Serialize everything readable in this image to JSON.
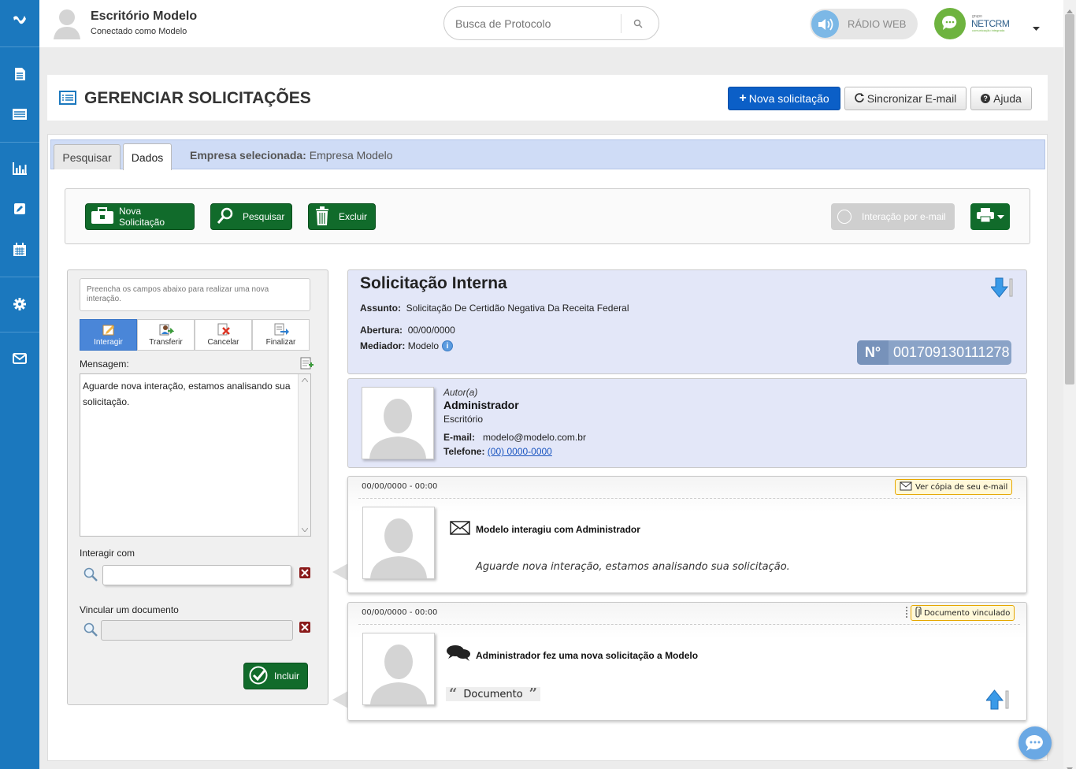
{
  "header": {
    "office_name": "Escritório Modelo",
    "connected_as": "Conectado como Modelo",
    "search_placeholder": "Busca de Protocolo",
    "radio_label": "RÁDIO WEB",
    "brand_name": "NETCRM",
    "brand_top": "grupo",
    "brand_sub": "comunicação integrada"
  },
  "page": {
    "title": "GERENCIAR SOLICITAÇÕES",
    "new_request": "Nova solicitação",
    "sync_email": "Sincronizar E-mail",
    "help": "Ajuda"
  },
  "tabs": [
    {
      "label": "Pesquisar",
      "active": false
    },
    {
      "label": "Dados",
      "active": true
    }
  ],
  "company_bar": {
    "label": "Empresa selecionada:",
    "value": "Empresa Modelo"
  },
  "toolbar": {
    "new": "Nova Solicitação",
    "search": "Pesquisar",
    "delete": "Excluir",
    "email_interaction": "Interação por e-mail"
  },
  "form": {
    "hint": "Preencha os campos abaixo para realizar uma nova interação.",
    "actions": [
      "Interagir",
      "Transferir",
      "Cancelar",
      "Finalizar"
    ],
    "message_label": "Mensagem:",
    "message_value": "Aguarde nova interação, estamos analisando sua solicitação.",
    "interact_with_label": "Interagir com",
    "link_document_label": "Vincular um documento",
    "include_button": "Incluir"
  },
  "request": {
    "title": "Solicitação Interna",
    "subject_label": "Assunto:",
    "subject": "Solicitação De Certidão Negativa Da Receita Federal",
    "opening_label": "Abertura:",
    "opening": "00/00/0000",
    "mediator_label": "Mediador:",
    "mediator": "Modelo",
    "number_label": "N°",
    "number": "001709130111278"
  },
  "author": {
    "role": "Autor(a)",
    "name": "Administrador",
    "org": "Escritório",
    "email_label": "E-mail:",
    "email": "modelo@modelo.com.br",
    "phone_label": "Telefone:",
    "phone": "(00) 0000-0000"
  },
  "interactions": [
    {
      "datetime": "00/00/0000 - 00:00",
      "badge": "Ver cópia de seu e-mail",
      "title": "Modelo interagiu com Administrador",
      "message": "Aguarde nova interação, estamos analisando sua solicitação."
    },
    {
      "datetime": "00/00/0000 - 00:00",
      "badge": "Documento vinculado",
      "title": "Administrador fez uma nova solicitação a Modelo",
      "document": "Documento"
    }
  ],
  "colors": {
    "sidebar": "#1b78be",
    "primary_button": "#0b5fc7",
    "green_button": "#116b2b",
    "panel_blue": "#e3e7f8",
    "tab_bar": "#cfdcf6"
  }
}
